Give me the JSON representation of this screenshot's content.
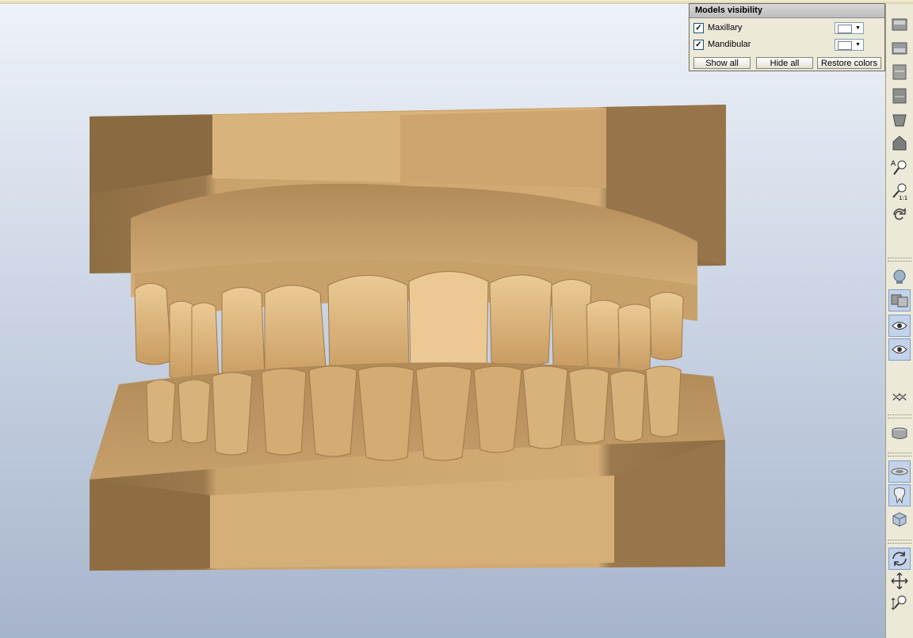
{
  "panel": {
    "title": "Models visibility",
    "models": [
      {
        "label": "Maxillary",
        "checked": true,
        "color": "#ffffff"
      },
      {
        "label": "Mandibular",
        "checked": true,
        "color": "#ffffff"
      }
    ],
    "buttons": {
      "show_all": "Show all",
      "hide_all": "Hide all",
      "restore_colors": "Restore colors"
    }
  },
  "colors": {
    "model_base": "#c8a06a",
    "model_light": "#e6c48f",
    "model_shadow": "#8e6d43",
    "viewport_top": "#eef2f8",
    "viewport_bottom": "#a6b4cc"
  },
  "toolbar": {
    "icons": [
      "upper-view-icon",
      "lower-view-icon",
      "front-view-icon",
      "back-view-icon",
      "occlusal-view-icon",
      "solid-view-icon",
      "zoom-auto-icon",
      "zoom-one-to-one-icon",
      "reset-rotation-icon",
      "head-orientation-icon",
      "models-toggle-icon",
      "show-maxillary-icon",
      "show-mandibular-icon",
      "occlusion-icon",
      "base-icon",
      "plane-icon",
      "tooth-icon",
      "cube-icon",
      "rotate-icon",
      "pan-icon",
      "zoom-icon"
    ],
    "active": [
      "models-toggle-icon",
      "show-maxillary-icon",
      "show-mandibular-icon",
      "plane-icon",
      "tooth-icon",
      "rotate-icon"
    ]
  }
}
